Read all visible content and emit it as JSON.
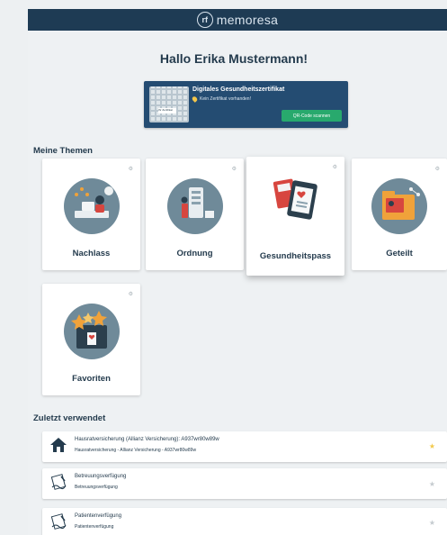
{
  "brand": {
    "logo_text": "rf",
    "name": "memoresa"
  },
  "greeting": "Hallo Erika Mustermann!",
  "certificate": {
    "image_label": "Ihr Zertifikat",
    "title": "Digitales Gesundheitszertifikat",
    "status": "Kein Zertifikat vorhanden!",
    "button": "QR-Code scannen"
  },
  "topics": {
    "heading": "Meine Themen",
    "settings_glyph": "⚙",
    "items": [
      {
        "label": "Nachlass",
        "icon": "desk-person-icon"
      },
      {
        "label": "Ordnung",
        "icon": "documents-organize-icon"
      },
      {
        "label": "Gesundheitspass",
        "icon": "health-pass-icon",
        "highlighted": true
      },
      {
        "label": "Geteilt",
        "icon": "shared-folder-icon"
      },
      {
        "label": "Favoriten",
        "icon": "favorites-folder-icon"
      }
    ]
  },
  "recent": {
    "heading": "Zuletzt verwendet",
    "items": [
      {
        "title": "Hausratversicherung (Allianz Versicherung): A937wr80w89w",
        "subtitle": "Hausratversicherung - Allianz Versicherung - A937wr80w89w",
        "icon": "house-icon",
        "favorite": true
      },
      {
        "title": "Betreuungsverfügung",
        "subtitle": "Betreuungsverfügung",
        "icon": "signature-document-icon",
        "favorite": false
      },
      {
        "title": "Patientenverfügung",
        "subtitle": "Patientenverfügung",
        "icon": "signature-document-icon",
        "favorite": false
      }
    ]
  },
  "colors": {
    "header": "#1e3b54",
    "certificate_card": "#244c72",
    "button_green": "#28a96d",
    "star_active": "#f2c94c",
    "star_inactive": "#c5cbcf"
  }
}
